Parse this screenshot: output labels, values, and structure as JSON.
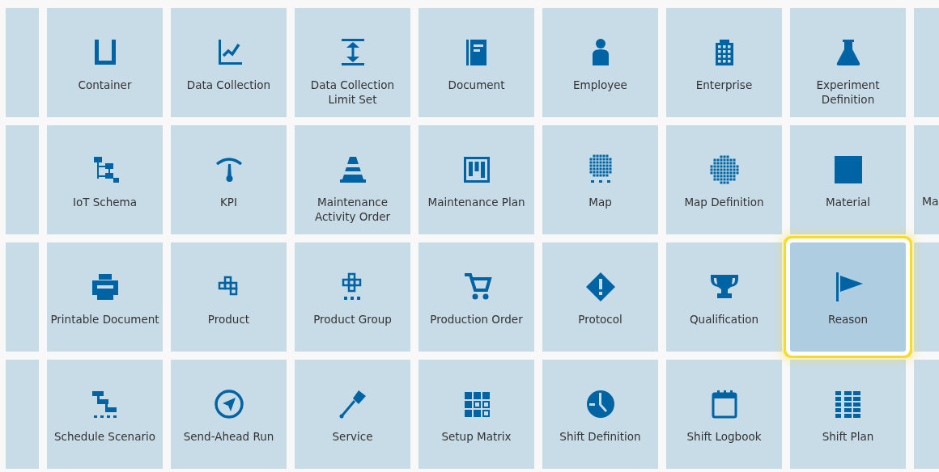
{
  "rows": [
    {
      "tiles": [
        {
          "label": "Container",
          "kind": "container",
          "selected": false
        },
        {
          "label": "Data Collection",
          "kind": "chart",
          "selected": false
        },
        {
          "label": "Data Collection Limit Set",
          "kind": "range",
          "selected": false
        },
        {
          "label": "Document",
          "kind": "document",
          "selected": false
        },
        {
          "label": "Employee",
          "kind": "person",
          "selected": false
        },
        {
          "label": "Enterprise",
          "kind": "building",
          "selected": false
        },
        {
          "label": "Experiment Definition",
          "kind": "flask",
          "selected": false
        }
      ]
    },
    {
      "tiles": [
        {
          "label": "IoT Schema",
          "kind": "tree",
          "selected": false
        },
        {
          "label": "KPI",
          "kind": "gauge",
          "selected": false
        },
        {
          "label": "Maintenance Activity Order",
          "kind": "cone",
          "selected": false
        },
        {
          "label": "Maintenance Plan",
          "kind": "board",
          "selected": false
        },
        {
          "label": "Map",
          "kind": "map",
          "selected": false
        },
        {
          "label": "Map Definition",
          "kind": "globe",
          "selected": false
        },
        {
          "label": "Material",
          "kind": "square",
          "selected": false
        }
      ],
      "clipped_right": "Ma"
    },
    {
      "tiles": [
        {
          "label": "Printable Document",
          "kind": "printer",
          "selected": false
        },
        {
          "label": "Product",
          "kind": "blocks",
          "selected": false
        },
        {
          "label": "Product Group",
          "kind": "blocksgroup",
          "selected": false
        },
        {
          "label": "Production Order",
          "kind": "cart",
          "selected": false
        },
        {
          "label": "Protocol",
          "kind": "diamond",
          "selected": false
        },
        {
          "label": "Qualification",
          "kind": "trophy",
          "selected": false
        },
        {
          "label": "Reason",
          "kind": "flag",
          "selected": true
        }
      ]
    },
    {
      "tiles": [
        {
          "label": "Schedule Scenario",
          "kind": "scenario",
          "selected": false
        },
        {
          "label": "Send-Ahead Run",
          "kind": "compass",
          "selected": false
        },
        {
          "label": "Service",
          "kind": "screwdriver",
          "selected": false
        },
        {
          "label": "Setup Matrix",
          "kind": "matrix",
          "selected": false
        },
        {
          "label": "Shift Definition",
          "kind": "clock",
          "selected": false
        },
        {
          "label": "Shift Logbook",
          "kind": "calendar",
          "selected": false
        },
        {
          "label": "Shift Plan",
          "kind": "plan",
          "selected": false
        }
      ]
    }
  ]
}
